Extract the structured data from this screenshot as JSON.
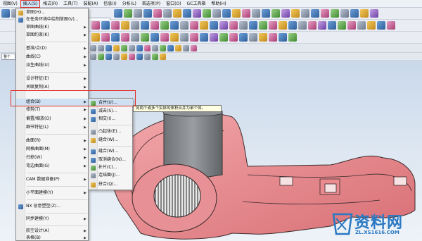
{
  "menubar": {
    "items": [
      {
        "label": "视图(V)"
      },
      {
        "label": "插入(S)"
      },
      {
        "label": "格式(R)"
      },
      {
        "label": "工具(T)"
      },
      {
        "label": "装配(A)"
      },
      {
        "label": "信息(I)"
      },
      {
        "label": "分析(L)"
      },
      {
        "label": "首选项(P)"
      },
      {
        "label": "窗口(O)"
      },
      {
        "label": "GC工具箱"
      },
      {
        "label": "帮助(H)"
      }
    ],
    "active_index": 1
  },
  "toolbar": {
    "combo_left": "整个",
    "combo_sel": "整个"
  },
  "insert_menu": {
    "items": [
      {
        "label": "草图(H)...",
        "icon": "sketch-icon",
        "submenu": false
      },
      {
        "label": "在任务环境中绘制草图(V)...",
        "icon": "sketch-task-icon",
        "submenu": false
      },
      {
        "label": "草图曲线(K)",
        "icon": "none",
        "submenu": true
      },
      {
        "label": "草图约束(K)",
        "icon": "none",
        "submenu": true
      },
      {
        "label": "基准/点(D)",
        "icon": "none",
        "submenu": true
      },
      {
        "label": "曲线(C)",
        "icon": "none",
        "submenu": true
      },
      {
        "label": "派生曲线(U)",
        "icon": "none",
        "submenu": true
      },
      {
        "label": "设计特征(E)",
        "icon": "none",
        "submenu": true
      },
      {
        "label": "关联复制(A)",
        "icon": "none",
        "submenu": true
      },
      {
        "label": "组合(B)",
        "icon": "none",
        "submenu": true
      },
      {
        "label": "修剪(T)",
        "icon": "none",
        "submenu": true
      },
      {
        "label": "偏置/缩放(O)",
        "icon": "none",
        "submenu": true
      },
      {
        "label": "细节特征(L)",
        "icon": "none",
        "submenu": true
      },
      {
        "label": "曲面(R)",
        "icon": "none",
        "submenu": true
      },
      {
        "label": "网格曲面(M)",
        "icon": "none",
        "submenu": true
      },
      {
        "label": "扫掠(W)",
        "icon": "none",
        "submenu": true
      },
      {
        "label": "弯边曲面(G)",
        "icon": "none",
        "submenu": true
      },
      {
        "label": "CAM 数据准备(P)",
        "icon": "none",
        "submenu": true
      },
      {
        "label": "小平面建模(Y)",
        "icon": "none",
        "submenu": true
      },
      {
        "label": "NX 创意塑型(Z)...",
        "icon": "nx-icon",
        "submenu": false
      },
      {
        "label": "同步建模(Y)",
        "icon": "none",
        "submenu": true
      },
      {
        "label": "航空设计(A)",
        "icon": "none",
        "submenu": true
      },
      {
        "label": "表格(B)",
        "icon": "none",
        "submenu": true
      }
    ],
    "highlight_index": 9
  },
  "combine_submenu": {
    "items": [
      {
        "label": "合并(U)...",
        "icon": "unite-icon"
      },
      {
        "label": "减去(S)...",
        "icon": "subtract-icon"
      },
      {
        "label": "相交(I)...",
        "icon": "intersect-icon"
      },
      {
        "label": "凸起体(E)...",
        "icon": "emboss-icon"
      },
      {
        "label": "缝合(W)...",
        "icon": "sew-icon"
      },
      {
        "label": "取消缝合(N)...",
        "icon": "unsew-icon"
      },
      {
        "label": "补片(C)...",
        "icon": "patch-icon"
      },
      {
        "label": "连结面(J)...",
        "icon": "join-face-icon"
      },
      {
        "label": "拼合(Q)...",
        "icon": "quilt-icon"
      }
    ],
    "highlight_index": 0
  },
  "tooltip": {
    "text": "将两个或多个实体的体积合并为单个体。"
  },
  "watermark": {
    "title": "资料网",
    "url": "ZL.XS1616.COM"
  },
  "colors": {
    "model_pink": "#e98b8f",
    "highlight": "#cfe0f3",
    "annotation_red": "#e0322b",
    "watermark_blue": "#2a78c2"
  }
}
